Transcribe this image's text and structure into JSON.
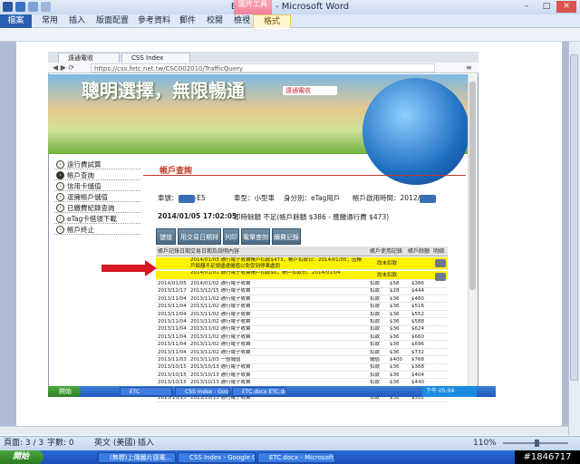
{
  "window": {
    "title": "ETC.docx - Microsoft Word",
    "context_tab": "圖片工具",
    "context_group": "格式"
  },
  "ribbon": {
    "file": "檔案",
    "tabs": [
      "常用",
      "插入",
      "版面配置",
      "參考資料",
      "郵件",
      "校閱",
      "檢視"
    ]
  },
  "browser": {
    "tabs": [
      "遠通電收",
      "CSS Index"
    ],
    "url": "https://css.fetc.net.tw/CSC002010/TrafficQuery",
    "banner_text": "聰明選擇，無限暢通",
    "logo_text": "遠通電收"
  },
  "sidebar": [
    {
      "label": "遠行費試算",
      "active": false
    },
    {
      "label": "帳戶查詢",
      "active": true
    },
    {
      "label": "信用卡儲值",
      "active": false
    },
    {
      "label": "逕擁帳戶儲值",
      "active": false
    },
    {
      "label": "已繳費紀錄查詢",
      "active": false
    },
    {
      "label": "eTag卡借領下載",
      "active": false
    },
    {
      "label": "帳戶終止",
      "active": false
    }
  ],
  "account": {
    "title": "帳戶查詢",
    "plate_label": "車號：",
    "plate_suffix": "-E5",
    "type": "車型：小型車",
    "identity": "身分別：eTag用戶",
    "open_label": "帳戶啟用時間：2012/",
    "date": "2014/01/05 17:02:05",
    "balance_text": "即時餘額 不足(帳戶餘額 $386 - 應繳通行費 $473)"
  },
  "buttons": [
    "儲值",
    "用交易日期排序",
    "列印",
    "電單查詢",
    "續費記錄"
  ],
  "table": {
    "headers": [
      "帳戶記錄日期",
      "交易日期及說明內容",
      "帳戶使用記錄",
      "帳戶餘額",
      "明細"
    ],
    "pending": [
      {
        "text": "2014/01/03 通行電子收費帳戶扣款$473，帳戶扣款日：2014/01/05；因帳戶餘額不足請儘速儲值以免受到停車處罰",
        "status": "尚未扣款"
      },
      {
        "text": "2014/01/01 通行電子收費帳戶扣款$0，帳戶扣款日：2014/01/04",
        "status": "尚未扣款"
      }
    ],
    "rows": [
      {
        "d": "2014/01/05",
        "desc": "2014/01/02 通行電子收費",
        "t": "扣款",
        "a": "$58",
        "b": "$386"
      },
      {
        "d": "2013/12/17",
        "desc": "2013/12/15 通行電子收費",
        "t": "扣款",
        "a": "$28",
        "b": "$444"
      },
      {
        "d": "2013/11/04",
        "desc": "2013/11/02 通行電子收費",
        "t": "扣款",
        "a": "$36",
        "b": "$480"
      },
      {
        "d": "2013/11/04",
        "desc": "2013/11/02 通行電子收費",
        "t": "扣款",
        "a": "$36",
        "b": "$516"
      },
      {
        "d": "2013/11/04",
        "desc": "2013/11/02 通行電子收費",
        "t": "扣款",
        "a": "$36",
        "b": "$552"
      },
      {
        "d": "2013/11/04",
        "desc": "2013/11/02 通行電子收費",
        "t": "扣款",
        "a": "$36",
        "b": "$588"
      },
      {
        "d": "2013/11/04",
        "desc": "2013/11/02 通行電子收費",
        "t": "扣款",
        "a": "$36",
        "b": "$624"
      },
      {
        "d": "2013/11/04",
        "desc": "2013/11/02 通行電子收費",
        "t": "扣款",
        "a": "$36",
        "b": "$660"
      },
      {
        "d": "2013/11/04",
        "desc": "2013/11/02 通行電子收費",
        "t": "扣款",
        "a": "$36",
        "b": "$696"
      },
      {
        "d": "2013/11/04",
        "desc": "2013/11/02 通行電子收費",
        "t": "扣款",
        "a": "$36",
        "b": "$732"
      },
      {
        "d": "2013/11/03",
        "desc": "2013/11/03 一般儲值",
        "t": "儲值",
        "a": "$400",
        "b": "$768"
      },
      {
        "d": "2013/10/15",
        "desc": "2013/10/13 通行電子收費",
        "t": "扣款",
        "a": "$36",
        "b": "$368"
      },
      {
        "d": "2013/10/15",
        "desc": "2013/10/13 通行電子收費",
        "t": "扣款",
        "a": "$36",
        "b": "$404"
      },
      {
        "d": "2013/10/15",
        "desc": "2013/10/13 通行電子收費",
        "t": "扣款",
        "a": "$36",
        "b": "$440"
      },
      {
        "d": "2013/10/15",
        "desc": "2013/10/13 通行電子收費",
        "t": "扣款",
        "a": "$36",
        "b": "$476"
      },
      {
        "d": "2013/10/15",
        "desc": "2013/10/13 通行電子收費",
        "t": "扣款",
        "a": "$36",
        "b": "$512"
      }
    ]
  },
  "inner_taskbar": {
    "start": "開始",
    "items": [
      "ETC",
      "CSS Index - Google C...",
      "ETC.docx ETC.docx"
    ],
    "tray": "下午 05:04"
  },
  "statusbar": {
    "page": "頁面: 3 / 3",
    "words": "字數: 0",
    "lang": "英文 (美國)",
    "mode": "插入",
    "zoom": "110%"
  },
  "taskbar": {
    "start": "開始",
    "items": [
      "(無標)上傳圖片感電...",
      "CSS Index - Google C...",
      "ETC.docx - Microsoft ..."
    ]
  },
  "watermark": "#1846717"
}
